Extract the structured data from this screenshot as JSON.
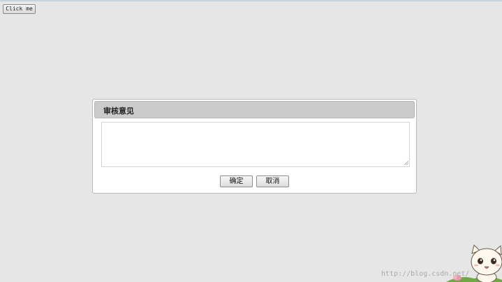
{
  "page": {
    "button_label": "Click me"
  },
  "dialog": {
    "title": "审核意见",
    "textarea_value": "",
    "confirm_label": "确定",
    "cancel_label": "取消"
  },
  "watermark": {
    "text": "http://blog.csdn.net/"
  },
  "colors": {
    "background": "#e6e6e6",
    "header": "#cbcbcb",
    "dialog": "#ffffff"
  }
}
